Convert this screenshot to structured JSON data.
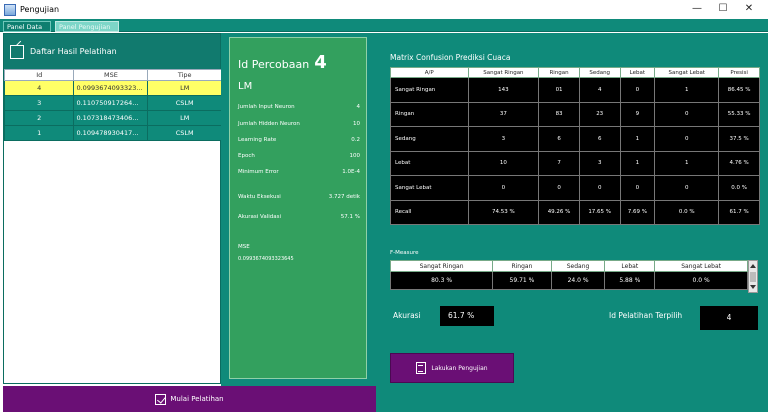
{
  "window": {
    "title": "Pengujian",
    "minimize": "—",
    "maximize": "☐",
    "close": "✕"
  },
  "tabs": [
    {
      "label": "Panel Data"
    },
    {
      "label": "Panel Pengujian"
    }
  ],
  "left": {
    "title": "Daftar Hasil Pelatihan",
    "columns": [
      "Id",
      "MSE",
      "Tipe"
    ],
    "rows": [
      {
        "id": "4",
        "mse": "0.0993674093323...",
        "tipe": "LM"
      },
      {
        "id": "3",
        "mse": "0.110750917264...",
        "tipe": "CSLM"
      },
      {
        "id": "2",
        "mse": "0.107318473406...",
        "tipe": "LM"
      },
      {
        "id": "1",
        "mse": "0.109478930417...",
        "tipe": "CSLM"
      }
    ],
    "train_button": "Mulai Pelatihan"
  },
  "middle": {
    "id_label": "Id Percobaan",
    "id_value": "4",
    "tipe": "LM",
    "params": [
      {
        "label": "Jumlah Input Neuron",
        "value": "4"
      },
      {
        "label": "Jumlah Hidden Neuron",
        "value": "10"
      },
      {
        "label": "Learning Rate",
        "value": "0.2"
      },
      {
        "label": "Epoch",
        "value": "100"
      },
      {
        "label": "Minimum Error",
        "value": "1.0E-4"
      },
      {
        "label": "Waktu Eksekusi",
        "value": "3.727 detik"
      },
      {
        "label": "Akurasi Validasi",
        "value": "57.1 %"
      }
    ],
    "mse_label": "MSE",
    "mse_value": "0.0993674093323645"
  },
  "right": {
    "matrix_title": "Matrix Confusion Prediksi Cuaca",
    "matrix_columns": [
      "A/P",
      "Sangat Ringan",
      "Ringan",
      "Sedang",
      "Lebat",
      "Sangat Lebat",
      "Presisi"
    ],
    "matrix_rows": [
      {
        "label": "Sangat Ringan",
        "cells": [
          "143",
          "01",
          "4",
          "0",
          "1",
          "86.45 %"
        ]
      },
      {
        "label": "Ringan",
        "cells": [
          "37",
          "83",
          "23",
          "9",
          "0",
          "55.33 %"
        ]
      },
      {
        "label": "Sedang",
        "cells": [
          "3",
          "6",
          "6",
          "1",
          "0",
          "37.5 %"
        ]
      },
      {
        "label": "Lebat",
        "cells": [
          "10",
          "7",
          "3",
          "1",
          "1",
          "4.76 %"
        ]
      },
      {
        "label": "Sangat Lebat",
        "cells": [
          "0",
          "0",
          "0",
          "0",
          "0",
          "0.0 %"
        ]
      },
      {
        "label": "Recall",
        "cells": [
          "74.53 %",
          "49.26 %",
          "17.65 %",
          "7.69 %",
          "0.0 %",
          "61.7 %"
        ]
      }
    ],
    "fmeasure_title": "F-Measure",
    "fmeasure_columns": [
      "Sangat Ringan",
      "Ringan",
      "Sedang",
      "Lebat",
      "Sangat Lebat"
    ],
    "fmeasure_values": [
      "80.3 %",
      "59.71 %",
      "24.0 %",
      "5.88 %",
      "0.0 %"
    ],
    "accuracy_label": "Akurasi",
    "accuracy_value": "61.7 %",
    "best_label": "Id Pelatihan Terpilih",
    "best_value": "4",
    "test_button": "Lakukan Pengujian"
  }
}
